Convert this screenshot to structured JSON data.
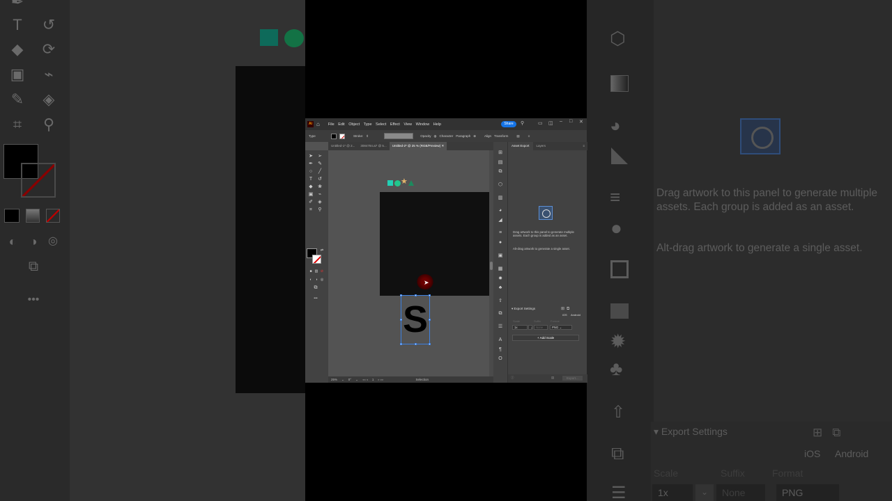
{
  "app": {
    "logo": "Ai",
    "menu": [
      "File",
      "Edit",
      "Object",
      "Type",
      "Select",
      "Effect",
      "View",
      "Window",
      "Help"
    ],
    "share_label": "Share",
    "control_bar": {
      "type_label": "Type",
      "stroke_label": "Stroke:",
      "opacity_label": "Opacity",
      "character_label": "Character",
      "paragraph_label": "Paragraph",
      "align_label": "Align",
      "transform_label": "Transform"
    },
    "tabs": [
      {
        "label": "Untitled-1* @ 2..."
      },
      {
        "label": "3084784.ai* @ 5..."
      },
      {
        "label": "Untitled-2* @ 25 % (RGB/Preview)"
      }
    ],
    "canvas": {
      "letter": "S"
    },
    "status": {
      "zoom": "25%",
      "rotation": "0°",
      "artboard": "1",
      "tool": "Selection"
    },
    "panel": {
      "tabs": [
        "Asset Export",
        "Layers"
      ],
      "hint1": "Drag artwork to this panel to generate multiple assets. Each group is added as an asset.",
      "hint2": "Alt-drag artwork to generate a single asset.",
      "export_settings": "Export Settings",
      "ios": "iOS",
      "android": "Android",
      "scale_label": "Scale",
      "suffix_label": "Suffix",
      "format_label": "Format",
      "scale_value": "1x",
      "suffix_placeholder": "None",
      "format_value": "PNG",
      "add_scale": "Add Scale",
      "export_btn": "Export..."
    }
  },
  "background_right": {
    "hint1": "Drag artwork to this panel to generate multiple assets. Each group is added as an asset.",
    "hint2": "Alt-drag artwork to generate a single asset.",
    "export_settings": "Export Settings",
    "ios": "iOS",
    "android": "Android",
    "scale_label": "Scale",
    "suffix_label": "Suffix",
    "format_label": "Format",
    "scale_value": "1x",
    "suffix_placeholder": "None",
    "format_value": "PNG"
  },
  "colors": {
    "accent": "#1473e6",
    "teal": "#22d0b5",
    "green": "#21c68c",
    "star": "#e3b56b",
    "selection": "#3d80e0"
  }
}
